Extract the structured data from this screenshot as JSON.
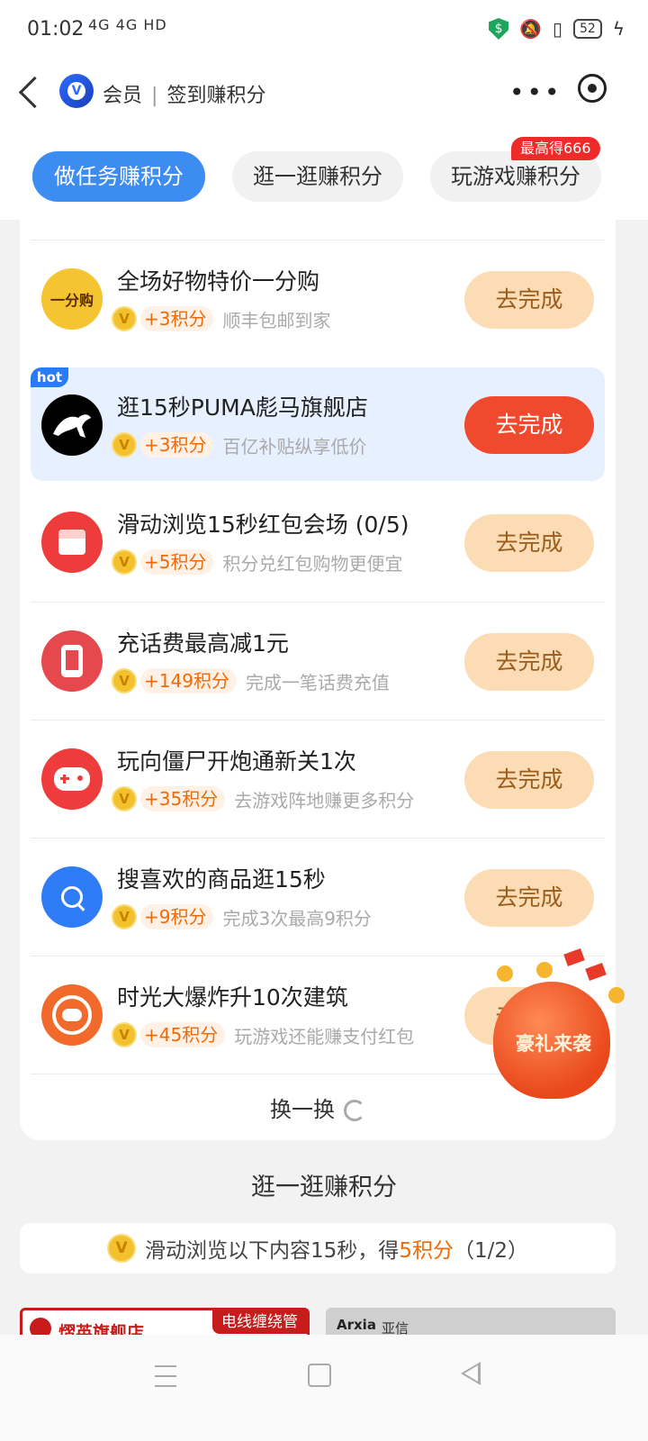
{
  "status_bar": {
    "time": "01:02",
    "signal": "4G 4G HD",
    "battery": "52"
  },
  "nav": {
    "app_name": "会员",
    "page_title": "签到赚积分"
  },
  "tabs": [
    {
      "label": "做任务赚积分",
      "active": true
    },
    {
      "label": "逛一逛赚积分",
      "active": false
    },
    {
      "label": "玩游戏赚积分",
      "active": false
    }
  ],
  "tab_badge": "最高得666",
  "hot_label": "hot",
  "tasks": [
    {
      "icon": "one-cent-buy-icon",
      "icon_text": "一分购",
      "title": "全场好物特价一分购",
      "points": "+3积分",
      "desc": "顺丰包邮到家",
      "button": "去完成",
      "hot": false
    },
    {
      "icon": "puma-logo-icon",
      "title": "逛15秒PUMA彪马旗舰店",
      "points": "+3积分",
      "desc": "百亿补贴纵享低价",
      "button": "去完成",
      "hot": true
    },
    {
      "icon": "red-packet-icon",
      "title": "滑动浏览15秒红包会场 (0/5)",
      "points": "+5积分",
      "desc": "积分兑红包购物更便宜",
      "button": "去完成",
      "hot": false
    },
    {
      "icon": "phone-icon",
      "title": "充话费最高减1元",
      "points": "+149积分",
      "desc": "完成一笔话费充值",
      "button": "去完成",
      "hot": false
    },
    {
      "icon": "gamepad-icon",
      "title": "玩向僵尸开炮通新关1次",
      "points": "+35积分",
      "desc": "去游戏阵地赚更多积分",
      "button": "去完成",
      "hot": false
    },
    {
      "icon": "search-icon",
      "title": "搜喜欢的商品逛15秒",
      "points": "+9积分",
      "desc": "完成3次最高9积分",
      "button": "去完成",
      "hot": false
    },
    {
      "icon": "game-controller-icon",
      "title": "时光大爆炸升10次建筑",
      "points": "+45积分",
      "desc": "玩游戏还能赚支付红包",
      "button": "去完成",
      "hot": false
    }
  ],
  "refresh_label": "换一换",
  "section2": {
    "title": "逛一逛赚积分",
    "tip_prefix": "滑动浏览以下内容15秒，得",
    "tip_highlight": "5积分",
    "tip_suffix": "（1/2）"
  },
  "products": [
    {
      "name": "熠英旗舰店",
      "badge": "电线缠绕管"
    },
    {
      "brand": "Arxia",
      "name": "亚信"
    }
  ],
  "floating_promo": "豪礼来袭",
  "coin_glyph": "V",
  "colors": {
    "accent_blue": "#3d8cf2",
    "points_orange": "#f06a08",
    "primary_button": "#f04a2e",
    "secondary_button": "#fbdcb5"
  }
}
